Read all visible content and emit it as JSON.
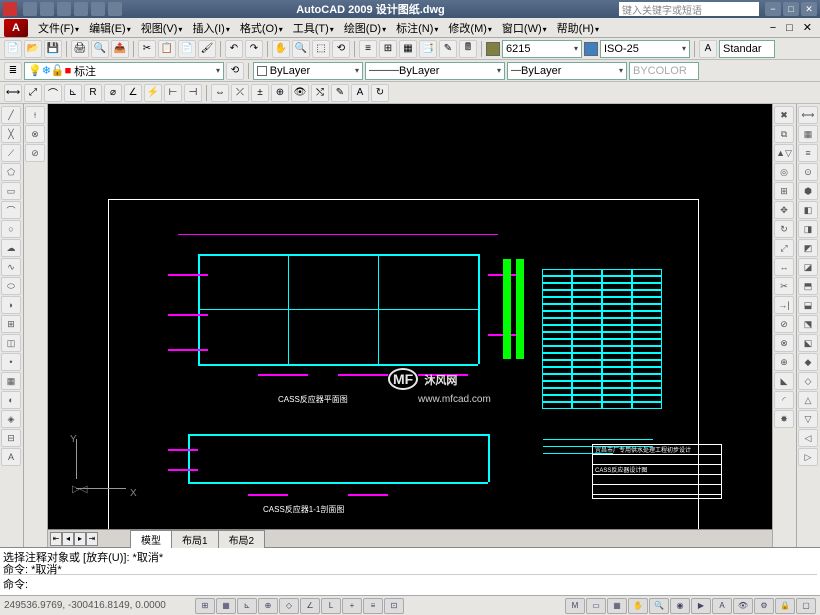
{
  "title": {
    "app": "AutoCAD 2009",
    "file": "设计图纸.dwg"
  },
  "search_placeholder": "键入关键字或短语",
  "menubar": [
    "文件(F)",
    "编辑(E)",
    "视图(V)",
    "插入(I)",
    "格式(O)",
    "工具(T)",
    "绘图(D)",
    "标注(N)",
    "修改(M)",
    "窗口(W)",
    "帮助(H)"
  ],
  "layer_combo": "标注",
  "props": {
    "color": "ByLayer",
    "linetype": "ByLayer",
    "lineweight": "ByLayer",
    "plotstyle": "BYCOLOR",
    "dim_value": "6215",
    "dim_style": "ISO-25",
    "text_style": "Standar"
  },
  "tabs": [
    "模型",
    "布局1",
    "布局2"
  ],
  "drawing": {
    "label1": "CASS反应器平面图",
    "label2": "CASS反应器1-1剖面图",
    "titleblock": [
      "宜昌市厂专用供水处理工程初步设计",
      "",
      "CASS反应器设计图",
      "",
      ""
    ]
  },
  "watermark": {
    "main": "沐风网",
    "sub": "www.mfcad.com"
  },
  "command": {
    "line1": "选择注释对象或 [放弃(U)]: *取消*",
    "line2": "命令: *取消*",
    "prompt": "命令:"
  },
  "status": {
    "coords": "249536.9769, -300416.8149, 0.0000"
  }
}
